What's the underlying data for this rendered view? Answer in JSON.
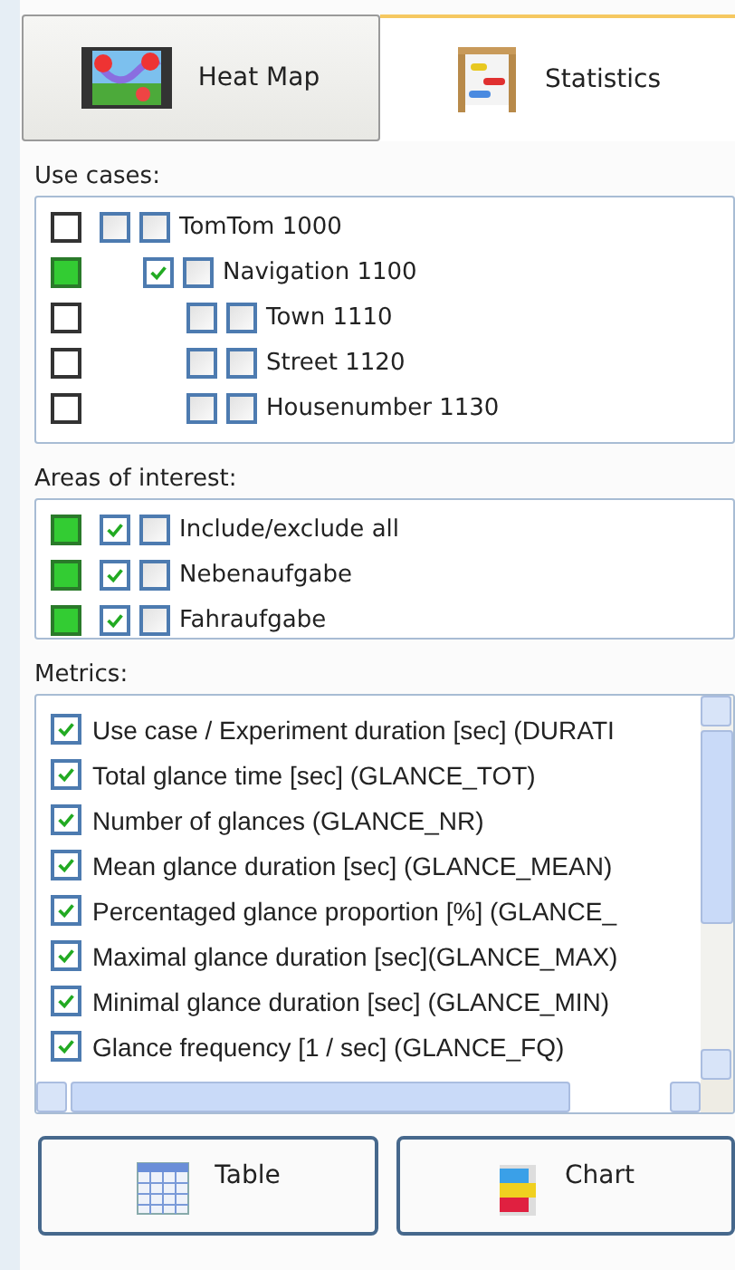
{
  "tabs": [
    {
      "label": "Heat Map",
      "selected": false
    },
    {
      "label": "Statistics",
      "selected": true
    }
  ],
  "use_cases": {
    "label": "Use cases:",
    "items": [
      {
        "label": "TomTom 1000",
        "color": "#ffffff",
        "checked": false,
        "excluded": false,
        "children": [
          {
            "label": "Navigation 1100",
            "color": "#33cc33",
            "checked": true,
            "excluded": false,
            "children": [
              {
                "label": "Town 1110",
                "color": "#ffffff",
                "checked": false,
                "excluded": false
              },
              {
                "label": "Street 1120",
                "color": "#ffffff",
                "checked": false,
                "excluded": false
              },
              {
                "label": "Housenumber 1130",
                "color": "#ffffff",
                "checked": false,
                "excluded": false
              }
            ]
          }
        ]
      }
    ]
  },
  "areas_of_interest": {
    "label": "Areas of interest:",
    "items": [
      {
        "label": "Include/exclude all",
        "color": "#33cc33",
        "checked": true,
        "excluded": false
      },
      {
        "label": "Nebenaufgabe",
        "color": "#33cc33",
        "checked": true,
        "excluded": false
      },
      {
        "label": "Fahraufgabe",
        "color": "#33cc33",
        "checked": true,
        "excluded": false
      }
    ]
  },
  "metrics": {
    "label": "Metrics:",
    "items": [
      {
        "label": "Use case / Experiment duration [sec] (DURATI",
        "checked": true
      },
      {
        "label": "Total glance time [sec] (GLANCE_TOT)",
        "checked": true
      },
      {
        "label": "Number of glances (GLANCE_NR)",
        "checked": true
      },
      {
        "label": "Mean glance duration [sec] (GLANCE_MEAN)",
        "checked": true
      },
      {
        "label": "Percentaged glance proportion [%] (GLANCE_",
        "checked": true
      },
      {
        "label": "Maximal glance duration [sec](GLANCE_MAX)",
        "checked": true
      },
      {
        "label": "Minimal glance duration [sec] (GLANCE_MIN)",
        "checked": true
      },
      {
        "label": "Glance frequency [1 / sec] (GLANCE_FQ)",
        "checked": true
      }
    ]
  },
  "buttons": [
    {
      "label": "Table"
    },
    {
      "label": "Chart"
    }
  ]
}
